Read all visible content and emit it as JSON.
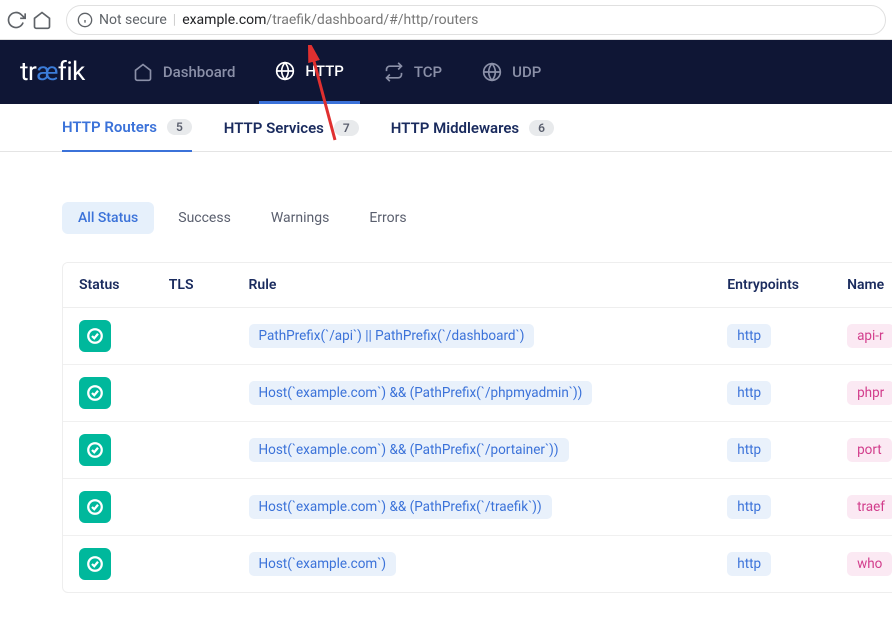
{
  "browser": {
    "not_secure": "Not secure",
    "url_domain": "example.com",
    "url_path": "/traefik/dashboard/#/http/routers"
  },
  "logo": {
    "t1": "tr",
    "ae": "æ",
    "t2": "fik"
  },
  "nav": {
    "dashboard": "Dashboard",
    "http": "HTTP",
    "tcp": "TCP",
    "udp": "UDP"
  },
  "sub_tabs": {
    "routers": {
      "label": "HTTP Routers",
      "count": "5"
    },
    "services": {
      "label": "HTTP Services",
      "count": "7"
    },
    "middlewares": {
      "label": "HTTP Middlewares",
      "count": "6"
    }
  },
  "filters": {
    "all": "All Status",
    "success": "Success",
    "warnings": "Warnings",
    "errors": "Errors"
  },
  "columns": {
    "status": "Status",
    "tls": "TLS",
    "rule": "Rule",
    "entrypoints": "Entrypoints",
    "name": "Name"
  },
  "rows": [
    {
      "rule": "PathPrefix(`/api`) || PathPrefix(`/dashboard`)",
      "entrypoint": "http",
      "name": "api-r"
    },
    {
      "rule": "Host(`example.com`) && (PathPrefix(`/phpmyadmin`))",
      "entrypoint": "http",
      "name": "phpr"
    },
    {
      "rule": "Host(`example.com`) && (PathPrefix(`/portainer`))",
      "entrypoint": "http",
      "name": "port"
    },
    {
      "rule": "Host(`example.com`) && (PathPrefix(`/traefik`))",
      "entrypoint": "http",
      "name": "traef"
    },
    {
      "rule": "Host(`example.com`)",
      "entrypoint": "http",
      "name": "who"
    }
  ]
}
